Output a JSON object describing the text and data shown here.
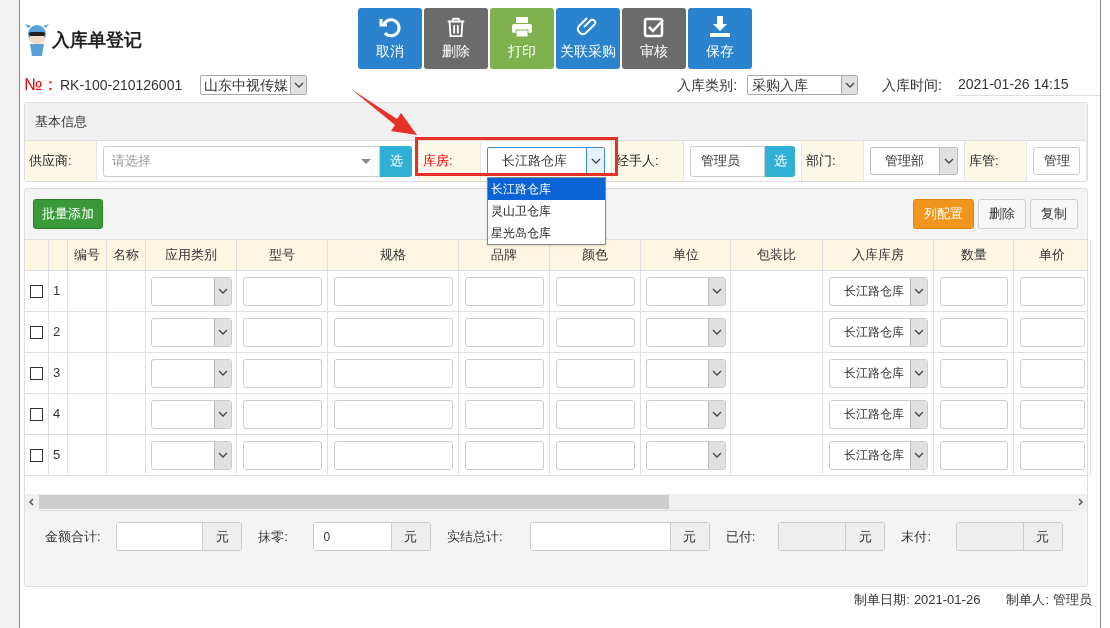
{
  "title": "入库单登记",
  "toolbar": [
    {
      "label": "取消",
      "kind": "undo",
      "color": "#2a83cc"
    },
    {
      "label": "删除",
      "kind": "trash",
      "color": "#6b6b6b"
    },
    {
      "label": "打印",
      "kind": "print",
      "color": "#7fb24e"
    },
    {
      "label": "关联采购",
      "kind": "clip",
      "color": "#2a83cc"
    },
    {
      "label": "审核",
      "kind": "check",
      "color": "#6b6b6b"
    },
    {
      "label": "保存",
      "kind": "save",
      "color": "#2a83cc"
    }
  ],
  "header": {
    "number_label": "№：",
    "number": "RK-100-210126001",
    "company": "山东中视传媒",
    "type_label": "入库类别:",
    "type": "采购入库",
    "time_label": "入库时间:",
    "time": "2021-01-26 14:15"
  },
  "basic_info": {
    "title": "基本信息",
    "fields": [
      {
        "label": "供应商:",
        "kind": "combo",
        "placeholder": "请选择",
        "button": "选",
        "required": false,
        "callout": false
      },
      {
        "label": "库房:",
        "kind": "select",
        "value": "长江路仓库",
        "required": true,
        "callout": true,
        "options": [
          {
            "label": "长江路仓库",
            "selected": true
          },
          {
            "label": "灵山卫仓库",
            "selected": false
          },
          {
            "label": "星光岛仓库",
            "selected": false
          }
        ]
      },
      {
        "label": "经手人:",
        "kind": "picker",
        "value": "管理员",
        "button": "选",
        "required": false,
        "callout": false
      },
      {
        "label": "部门:",
        "kind": "select",
        "value": "管理部",
        "required": false,
        "callout": false
      },
      {
        "label": "库管:",
        "kind": "text",
        "value": "管理",
        "required": false,
        "callout": false
      }
    ]
  },
  "items": {
    "add_button": "批量添加",
    "actions": [
      {
        "label": "列配置",
        "kind": "primary"
      },
      {
        "label": "删除",
        "kind": "plain"
      },
      {
        "label": "复制",
        "kind": "plain"
      }
    ],
    "columns": [
      "",
      "",
      "编号",
      "名称",
      "应用类别",
      "型号",
      "规格",
      "品牌",
      "颜色",
      "单位",
      "包装比",
      "入库库房",
      "数量",
      "单价"
    ],
    "rows": [
      {
        "no": "1",
        "checked": false,
        "warehouse": "长江路仓库"
      },
      {
        "no": "2",
        "checked": false,
        "warehouse": "长江路仓库"
      },
      {
        "no": "3",
        "checked": false,
        "warehouse": "长江路仓库"
      },
      {
        "no": "4",
        "checked": false,
        "warehouse": "长江路仓库"
      },
      {
        "no": "5",
        "checked": false,
        "warehouse": "长江路仓库"
      }
    ]
  },
  "totals": [
    {
      "label": "金额合计:",
      "unit": "元",
      "disabled": false
    },
    {
      "label": "抹零:",
      "value": "0",
      "unit": "元",
      "disabled": false
    },
    {
      "label": "实结总计:",
      "unit": "元",
      "disabled": false
    },
    {
      "label": "已付:",
      "unit": "元",
      "disabled": true
    },
    {
      "label": "末付:",
      "unit": "元",
      "disabled": true
    }
  ],
  "footer": {
    "date_label": "制单日期:",
    "date": "2021-01-26",
    "maker_label": "制单人:",
    "maker": "管理员"
  }
}
